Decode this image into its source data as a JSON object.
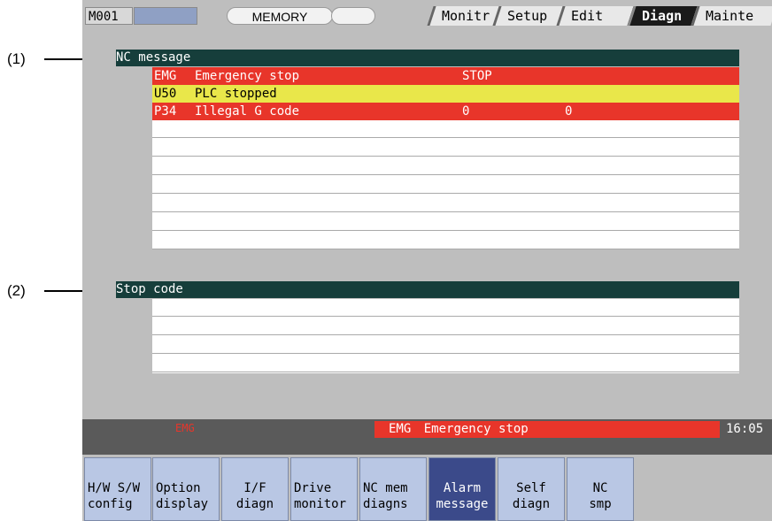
{
  "callouts": {
    "c1": "(1)",
    "c2": "(2)"
  },
  "topbar": {
    "program": "M001",
    "mode": "MEMORY",
    "tabs": [
      "Monitr",
      "Setup",
      "Edit",
      "Diagn",
      "Mainte"
    ],
    "active_tab": "Diagn"
  },
  "nc_message": {
    "title": "NC message",
    "rows": [
      {
        "code": "EMG",
        "text": "Emergency stop",
        "col3": "STOP",
        "col4": "",
        "color": "#e8352a"
      },
      {
        "code": "U50",
        "text": "PLC stopped",
        "col3": "",
        "col4": "",
        "color": "#e9e74a"
      },
      {
        "code": "P34",
        "text": "Illegal G code",
        "col3": "0",
        "col4": "0",
        "color": "#e8352a"
      }
    ]
  },
  "stop_code": {
    "title": "Stop code"
  },
  "status_bar": {
    "left_text": "EMG",
    "message_code": "EMG",
    "message": "Emergency stop",
    "time": "16:05"
  },
  "menu": [
    {
      "line1": "H/W S/W",
      "line2": "config"
    },
    {
      "line1": "Option",
      "line2": "display"
    },
    {
      "line1": "I/F",
      "line2": "diagn"
    },
    {
      "line1": "Drive",
      "line2": "monitor"
    },
    {
      "line1": "NC mem",
      "line2": "diagns"
    },
    {
      "line1": "Alarm",
      "line2": "message"
    },
    {
      "line1": "Self",
      "line2": "diagn"
    },
    {
      "line1": "NC",
      "line2": "smp"
    }
  ]
}
